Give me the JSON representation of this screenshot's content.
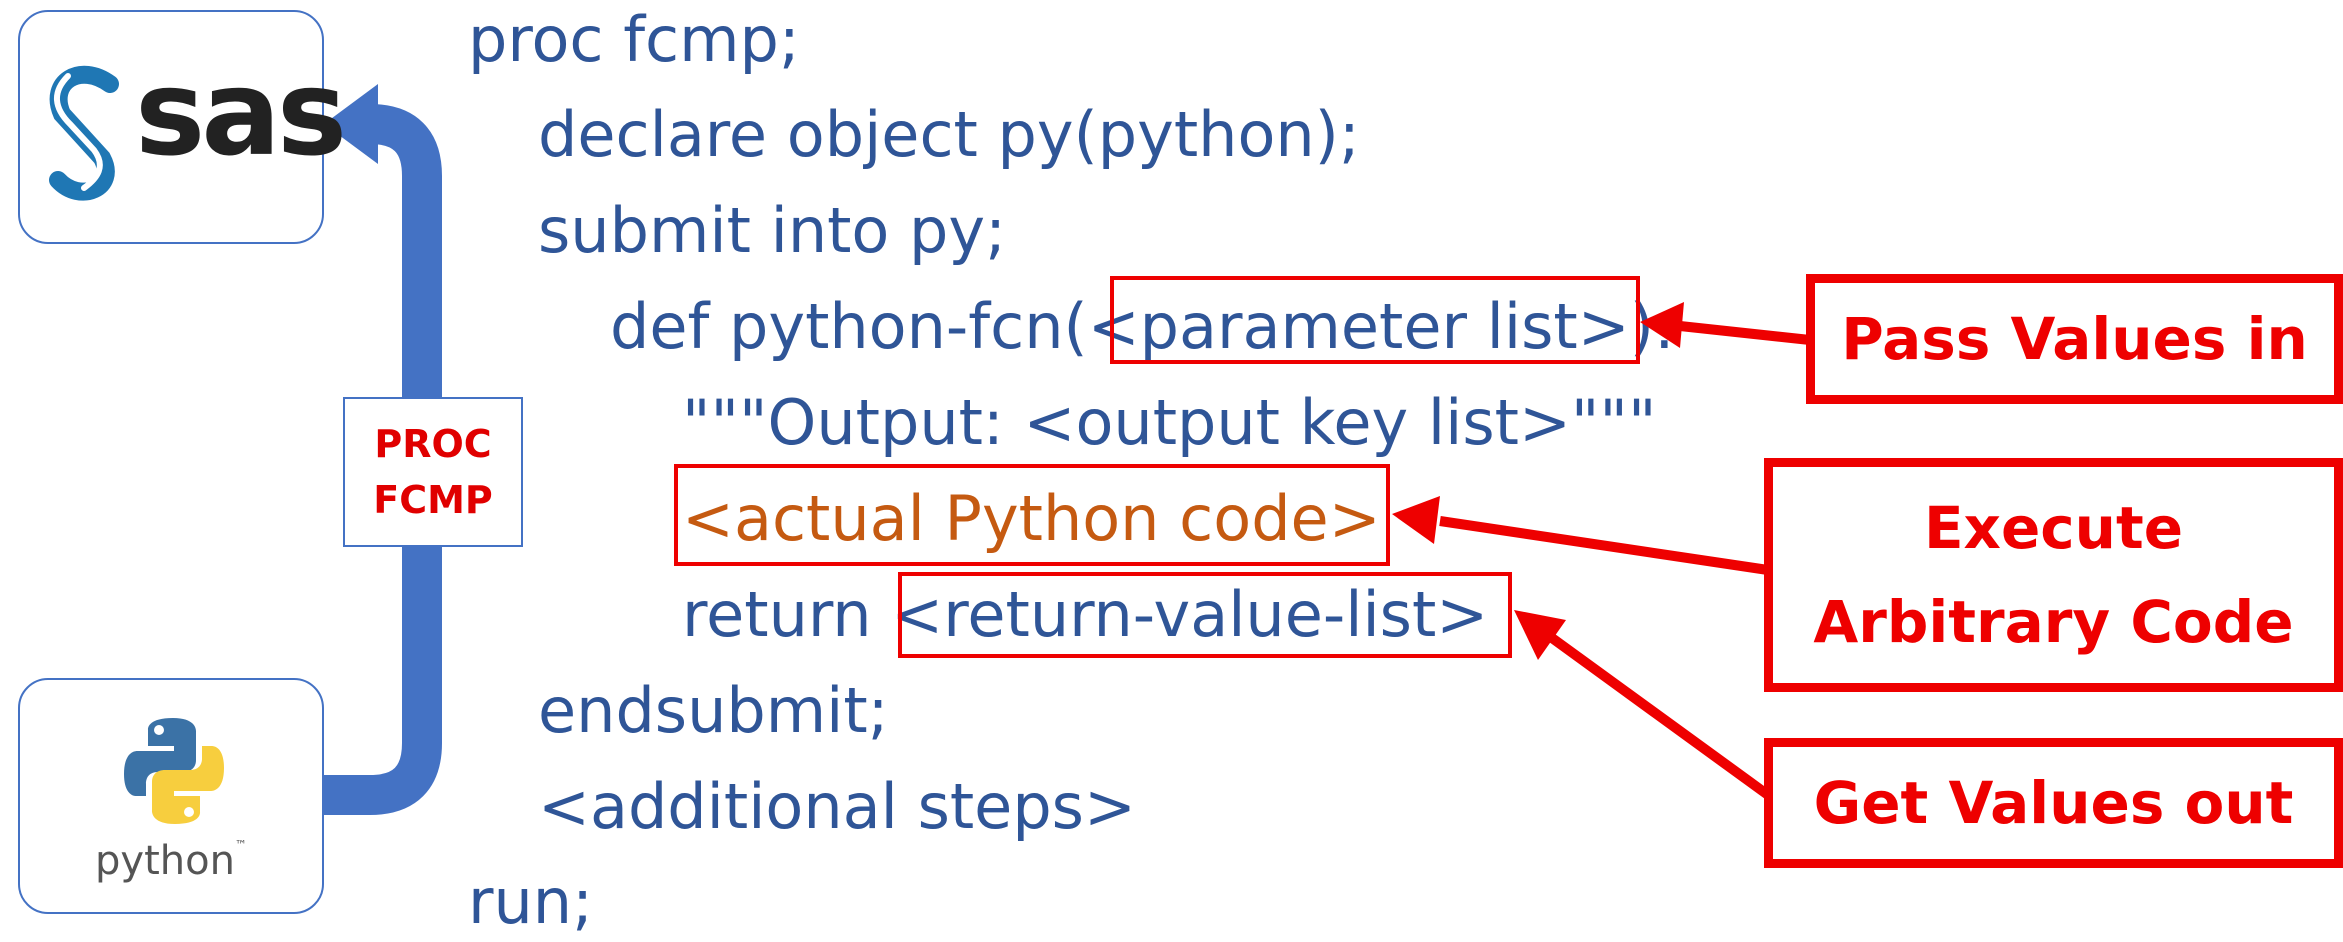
{
  "logos": {
    "sas": {
      "word": "sas",
      "icon": "sas-s-icon"
    },
    "python": {
      "word": "python",
      "trademark": "™",
      "icon": "python-snakes-icon"
    }
  },
  "pipe_label": {
    "line1": "PROC",
    "line2": "FCMP"
  },
  "code": {
    "line1": "proc fcmp;",
    "line2": "declare object py(python);",
    "line3": "submit into py;",
    "line4_prefix": "def python-fcn(",
    "line4_param": "<parameter list>",
    "line4_suffix": "):",
    "line5": "\"\"\"Output: <output key list>\"\"\"",
    "line6": "<actual Python code>",
    "line7_keyword": "return ",
    "line7_value": "<return-value-list>",
    "line8": "endsubmit;",
    "line9": "<additional steps>",
    "line10": "run;"
  },
  "callouts": {
    "pass_in": "Pass Values in",
    "execute_line1": "Execute",
    "execute_line2": "Arbitrary Code",
    "get_out": "Get Values out"
  },
  "colors": {
    "code_blue": "#2F5597",
    "code_orange": "#C55A11",
    "highlight_red": "#EE0000",
    "pipe_blue": "#4472C4"
  }
}
